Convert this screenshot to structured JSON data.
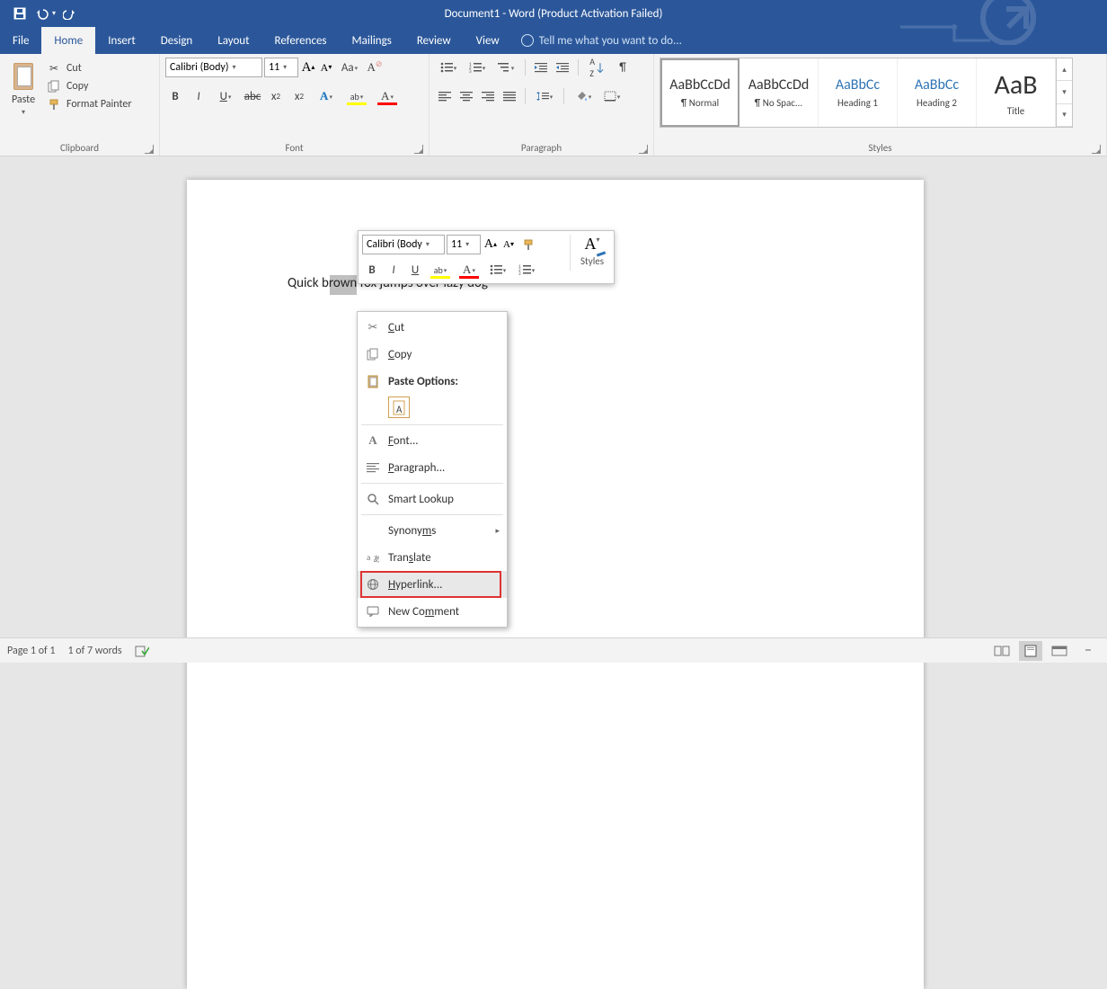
{
  "titlebar": {
    "document_title": "Document1 - Word (Product Activation Failed)"
  },
  "qat": {
    "save": "save-icon",
    "undo": "undo-icon",
    "redo": "redo-icon"
  },
  "tabs": {
    "file": "File",
    "home": "Home",
    "insert": "Insert",
    "design": "Design",
    "layout": "Layout",
    "references": "References",
    "mailings": "Mailings",
    "review": "Review",
    "view": "View",
    "tellme_placeholder": "Tell me what you want to do..."
  },
  "ribbon": {
    "clipboard": {
      "label": "Clipboard",
      "paste": "Paste",
      "cut": "Cut",
      "copy": "Copy",
      "format_painter": "Format Painter"
    },
    "font": {
      "label": "Font",
      "font_name": "Calibri (Body)",
      "font_size": "11"
    },
    "paragraph": {
      "label": "Paragraph"
    },
    "styles": {
      "label": "Styles",
      "items": [
        {
          "sample": "AaBbCcDd",
          "name": "¶ Normal",
          "variant": "n",
          "selected": true
        },
        {
          "sample": "AaBbCcDd",
          "name": "¶ No Spac...",
          "variant": "n",
          "selected": false
        },
        {
          "sample": "AaBbCc",
          "name": "Heading 1",
          "variant": "h",
          "selected": false
        },
        {
          "sample": "AaBbCc",
          "name": "Heading 2",
          "variant": "h",
          "selected": false
        },
        {
          "sample": "AaB",
          "name": "Title",
          "variant": "title",
          "selected": false
        }
      ]
    }
  },
  "document": {
    "body_text": "Quick brown fox jumps over lazy dog"
  },
  "mini_toolbar": {
    "font_name": "Calibri (Body",
    "font_size": "11",
    "styles_label": "Styles"
  },
  "context_menu": {
    "cut": "Cut",
    "copy": "Copy",
    "paste_options": "Paste Options:",
    "font": "Font...",
    "paragraph": "Paragraph...",
    "smart_lookup": "Smart Lookup",
    "synonyms": "Synonyms",
    "translate": "Translate",
    "hyperlink": "Hyperlink...",
    "new_comment": "New Comment"
  },
  "statusbar": {
    "page": "Page 1 of 1",
    "words": "1 of 7 words",
    "zoom_minus": "−"
  }
}
